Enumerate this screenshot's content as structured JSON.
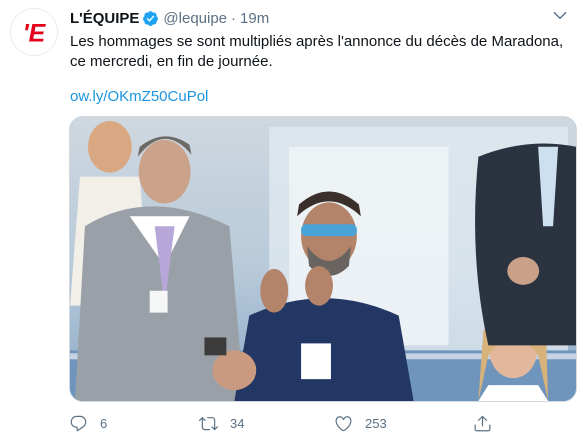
{
  "account": {
    "display_name": "L'ÉQUIPE",
    "handle": "@lequipe",
    "separator": "·",
    "time": "19m",
    "avatar_letter": "'E",
    "verified_icon": "verified-badge-icon",
    "brand_color": "#e2001a"
  },
  "tweet": {
    "text": "Les hommages se sont multipliés après l'annonce du décès de Maradona, ce mercredi, en fin de journée.",
    "link": "ow.ly/OKmZ50CuPol"
  },
  "actions": {
    "reply_count": "6",
    "retweet_count": "34",
    "like_count": "253",
    "reply_icon": "reply-icon",
    "retweet_icon": "retweet-icon",
    "like_icon": "heart-icon",
    "share_icon": "share-icon"
  },
  "colors": {
    "text": "#0f1419",
    "secondary": "#5b7083",
    "link": "#1b95e0",
    "verified": "#1da1f2"
  }
}
